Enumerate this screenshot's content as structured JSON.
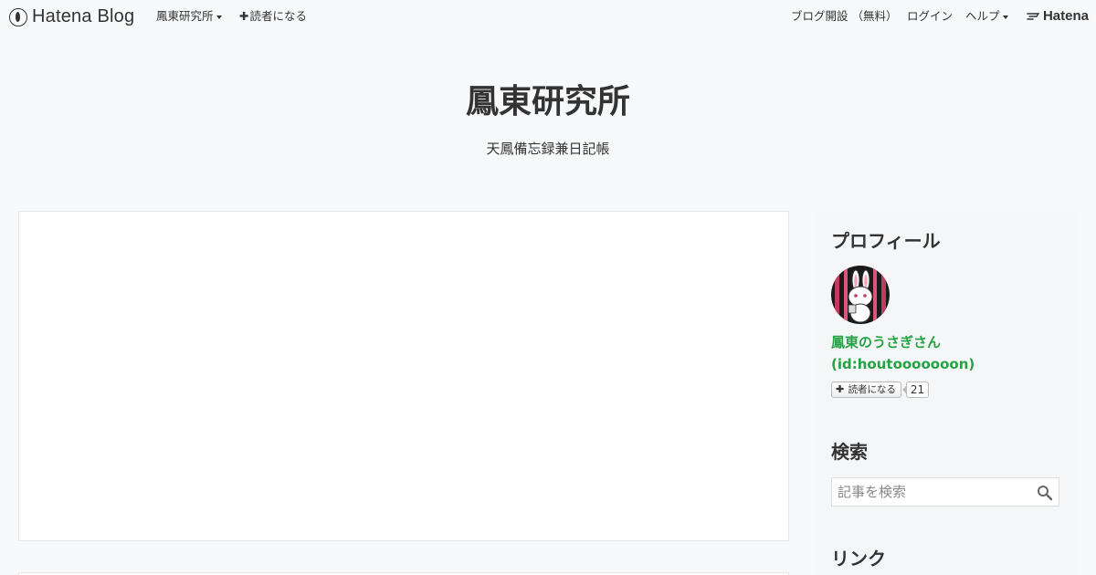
{
  "topbar": {
    "logo": "Hatena Blog",
    "blog_menu": "鳳東研究所",
    "subscribe": "読者になる",
    "open_blog": "ブログ開設 （無料）",
    "login": "ログイン",
    "help": "ヘルプ",
    "brand": "Hatena"
  },
  "blog": {
    "title": "鳳東研究所",
    "description": "天鳳備忘録兼日記帳"
  },
  "sidebar": {
    "profile": {
      "heading": "プロフィール",
      "name": "鳳東のうさぎさん",
      "id": "(id:houtooooooon)",
      "subscribe_label": "読者になる",
      "subscriber_count": "21"
    },
    "search": {
      "heading": "検索",
      "placeholder": "記事を検索"
    },
    "links": {
      "heading": "リンク"
    }
  },
  "colors": {
    "accent_green": "#25a244",
    "background": "#f8f9fa"
  },
  "icons": [
    "hatena-blog-logo-icon",
    "caret-down-icon",
    "plus-icon",
    "hatena-brand-icon",
    "search-icon"
  ]
}
